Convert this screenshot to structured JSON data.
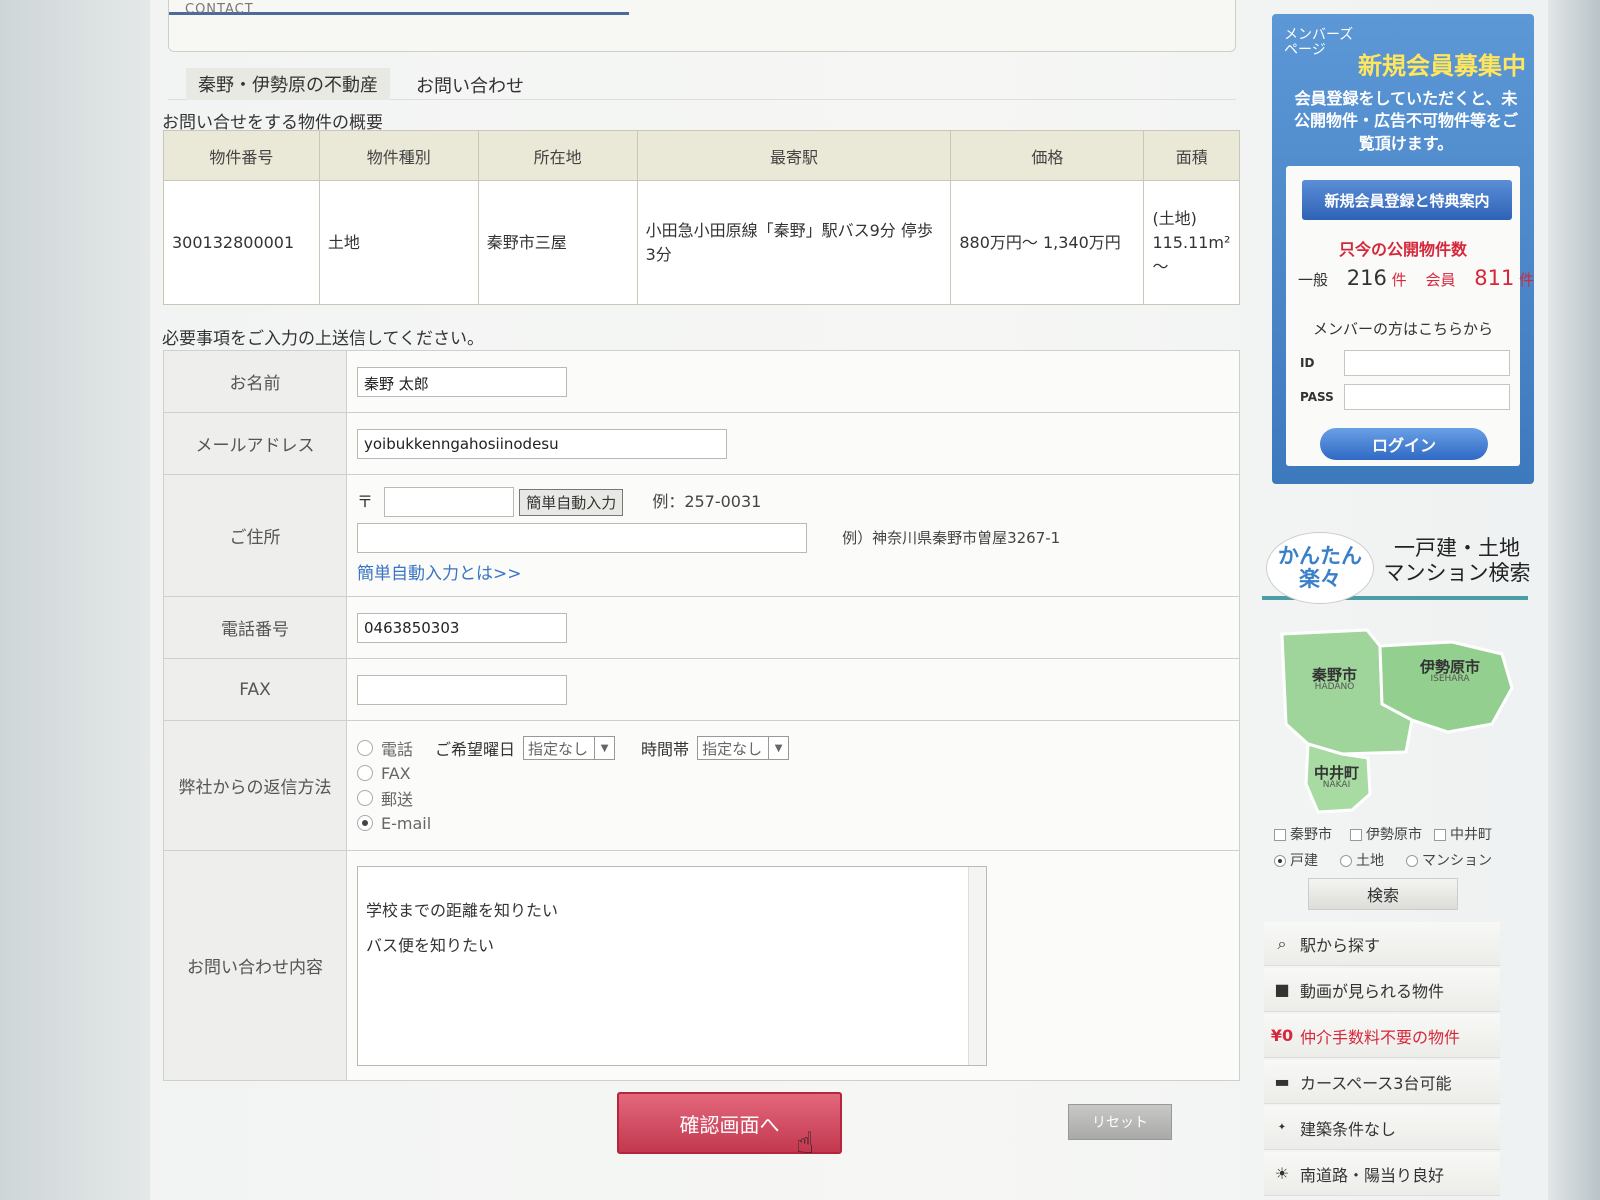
{
  "header": {
    "contact_label": "CONTACT"
  },
  "breadcrumb": {
    "home": "秦野・伊勢原の不動産",
    "current": "お問い合わせ"
  },
  "property_section": {
    "title": "お問い合せをする物件の概要",
    "headers": [
      "物件番号",
      "物件種別",
      "所在地",
      "最寄駅",
      "価格",
      "面積"
    ],
    "row": {
      "number": "300132800001",
      "type": "土地",
      "location": "秦野市三屋",
      "station": "小田急小田原線「秦野」駅バス9分 停歩3分",
      "price": "880万円～ 1,340万円",
      "area_label": "(土地)",
      "area_value": "115.11m²",
      "area_suffix": "～"
    }
  },
  "form": {
    "intro": "必要事項をご入力の上送信してください。",
    "name_label": "お名前",
    "name_value": "秦野 太郎",
    "email_label": "メールアドレス",
    "email_value": "yoibukkenngahosiinodesu",
    "address_label": "ご住所",
    "postal_mark": "〒",
    "postal_value": "",
    "auto_input_button": "簡単自動入力",
    "postal_example": "例：257-0031",
    "address_value": "",
    "address_example": "例）神奈川県秦野市曽屋3267-1",
    "auto_input_link": "簡単自動入力とは>>",
    "phone_label": "電話番号",
    "phone_value": "0463850303",
    "fax_label": "FAX",
    "fax_value": "",
    "reply_label": "弊社からの返信方法",
    "reply_options": [
      "電話",
      "FAX",
      "郵送",
      "E-mail"
    ],
    "reply_selected": "E-mail",
    "day_label": "ご希望曜日",
    "day_value": "指定なし",
    "time_label": "時間帯",
    "time_value": "指定なし",
    "inquiry_label": "お問い合わせ内容",
    "inquiry_line1": "学校までの距離を知りたい",
    "inquiry_line2": "バス便を知りたい",
    "confirm_button": "確認画面へ",
    "reset_button": "リセット"
  },
  "sidebar": {
    "member_small": "メンバーズ ページ",
    "member_head": "新規会員募集中",
    "member_text": "会員登録をしていただくと、未公開物件・広告不可物件等をご覧頂けます。",
    "register_button": "新規会員登録と特典案内",
    "count_title": "只今の公開物件数",
    "general_label": "一般",
    "general_count": "216",
    "member_label": "会員",
    "member_count": "811",
    "unit": "件",
    "login_note": "メンバーの方はこちらから",
    "id_label": "ID",
    "pass_label": "PASS",
    "login_button": "ログイン",
    "easy_label": "かんたん 楽々",
    "search_title": "一戸建・土地 マンション検索",
    "map_areas": [
      {
        "name": "秦野市",
        "romaji": "HADANO"
      },
      {
        "name": "伊勢原市",
        "romaji": "ISEHARA"
      },
      {
        "name": "中井町",
        "romaji": "NAKAI"
      }
    ],
    "area_checks": [
      "秦野市",
      "伊勢原市",
      "中井町"
    ],
    "type_radios": [
      "戸建",
      "土地",
      "マンション"
    ],
    "type_selected": "戸建",
    "search_button": "検索",
    "menu": [
      {
        "icon": "search-icon",
        "label": "駅から探す"
      },
      {
        "icon": "video-camera-icon",
        "label": "動画が見られる物件"
      },
      {
        "icon": "yen-icon",
        "label": "仲介手数料不要の物件",
        "badge": "¥0"
      },
      {
        "icon": "car-icon",
        "label": "カースペース3台可能"
      },
      {
        "icon": "free-icon",
        "label": "建築条件なし"
      },
      {
        "icon": "sun-icon",
        "label": "南道路・陽当り良好"
      }
    ]
  },
  "colors": {
    "accent": "#c2384f",
    "member_blue": "#3d79bd",
    "link": "#3a75c4",
    "table_header": "#eae8d6"
  }
}
